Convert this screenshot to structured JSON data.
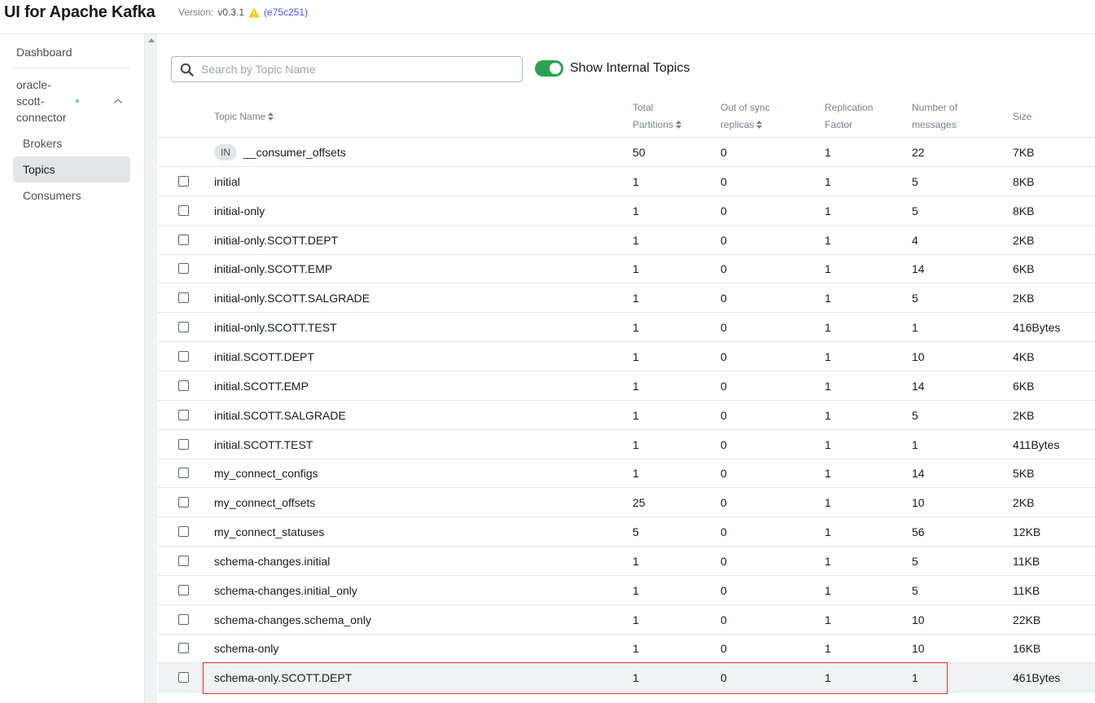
{
  "header": {
    "title": "UI for Apache Kafka",
    "version_label": "Version:",
    "version": "v0.3.1",
    "commit": "(e75c251)"
  },
  "sidebar": {
    "dashboard": "Dashboard",
    "cluster_name": "oracle-\nscott-\nconnector",
    "cluster_lines": [
      "oracle-",
      "scott-",
      "connector"
    ],
    "items": [
      {
        "label": "Brokers",
        "active": false
      },
      {
        "label": "Topics",
        "active": true
      },
      {
        "label": "Consumers",
        "active": false
      }
    ]
  },
  "toolbar": {
    "search_placeholder": "Search by Topic Name",
    "search_value": "",
    "show_internal_label": "Show Internal Topics",
    "show_internal_on": true
  },
  "table": {
    "headers": {
      "topic_name": "Topic Name",
      "total_partitions": [
        "Total",
        "Partitions"
      ],
      "out_of_sync": [
        "Out of sync",
        "replicas"
      ],
      "replication": [
        "Replication",
        "Factor"
      ],
      "messages": [
        "Number of",
        "messages"
      ],
      "size": "Size"
    },
    "internal_badge": "IN",
    "rows": [
      {
        "name": "__consumer_offsets",
        "internal": true,
        "partitions": "50",
        "out_of_sync": "0",
        "replication": "1",
        "messages": "22",
        "size": "7KB"
      },
      {
        "name": "initial",
        "internal": false,
        "partitions": "1",
        "out_of_sync": "0",
        "replication": "1",
        "messages": "5",
        "size": "8KB"
      },
      {
        "name": "initial-only",
        "internal": false,
        "partitions": "1",
        "out_of_sync": "0",
        "replication": "1",
        "messages": "5",
        "size": "8KB"
      },
      {
        "name": "initial-only.SCOTT.DEPT",
        "internal": false,
        "partitions": "1",
        "out_of_sync": "0",
        "replication": "1",
        "messages": "4",
        "size": "2KB"
      },
      {
        "name": "initial-only.SCOTT.EMP",
        "internal": false,
        "partitions": "1",
        "out_of_sync": "0",
        "replication": "1",
        "messages": "14",
        "size": "6KB"
      },
      {
        "name": "initial-only.SCOTT.SALGRADE",
        "internal": false,
        "partitions": "1",
        "out_of_sync": "0",
        "replication": "1",
        "messages": "5",
        "size": "2KB"
      },
      {
        "name": "initial-only.SCOTT.TEST",
        "internal": false,
        "partitions": "1",
        "out_of_sync": "0",
        "replication": "1",
        "messages": "1",
        "size": "416Bytes"
      },
      {
        "name": "initial.SCOTT.DEPT",
        "internal": false,
        "partitions": "1",
        "out_of_sync": "0",
        "replication": "1",
        "messages": "10",
        "size": "4KB"
      },
      {
        "name": "initial.SCOTT.EMP",
        "internal": false,
        "partitions": "1",
        "out_of_sync": "0",
        "replication": "1",
        "messages": "14",
        "size": "6KB"
      },
      {
        "name": "initial.SCOTT.SALGRADE",
        "internal": false,
        "partitions": "1",
        "out_of_sync": "0",
        "replication": "1",
        "messages": "5",
        "size": "2KB"
      },
      {
        "name": "initial.SCOTT.TEST",
        "internal": false,
        "partitions": "1",
        "out_of_sync": "0",
        "replication": "1",
        "messages": "1",
        "size": "411Bytes"
      },
      {
        "name": "my_connect_configs",
        "internal": false,
        "partitions": "1",
        "out_of_sync": "0",
        "replication": "1",
        "messages": "14",
        "size": "5KB"
      },
      {
        "name": "my_connect_offsets",
        "internal": false,
        "partitions": "25",
        "out_of_sync": "0",
        "replication": "1",
        "messages": "10",
        "size": "2KB"
      },
      {
        "name": "my_connect_statuses",
        "internal": false,
        "partitions": "5",
        "out_of_sync": "0",
        "replication": "1",
        "messages": "56",
        "size": "12KB"
      },
      {
        "name": "schema-changes.initial",
        "internal": false,
        "partitions": "1",
        "out_of_sync": "0",
        "replication": "1",
        "messages": "5",
        "size": "11KB"
      },
      {
        "name": "schema-changes.initial_only",
        "internal": false,
        "partitions": "1",
        "out_of_sync": "0",
        "replication": "1",
        "messages": "5",
        "size": "11KB"
      },
      {
        "name": "schema-changes.schema_only",
        "internal": false,
        "partitions": "1",
        "out_of_sync": "0",
        "replication": "1",
        "messages": "10",
        "size": "22KB"
      },
      {
        "name": "schema-only",
        "internal": false,
        "partitions": "1",
        "out_of_sync": "0",
        "replication": "1",
        "messages": "10",
        "size": "16KB"
      },
      {
        "name": "schema-only.SCOTT.DEPT",
        "internal": false,
        "partitions": "1",
        "out_of_sync": "0",
        "replication": "1",
        "messages": "1",
        "size": "461Bytes",
        "hover": true
      }
    ],
    "row_menu_glyph": "⋮"
  },
  "colors": {
    "accent_green": "#29a352",
    "highlight_red": "#d9342b",
    "warning_yellow": "#ffc500",
    "link_blue": "#4f4fff"
  },
  "icons": {
    "warning": "warning-icon",
    "search": "search-icon",
    "sort": "sort-icon",
    "chevron": "chevron-up-icon"
  }
}
